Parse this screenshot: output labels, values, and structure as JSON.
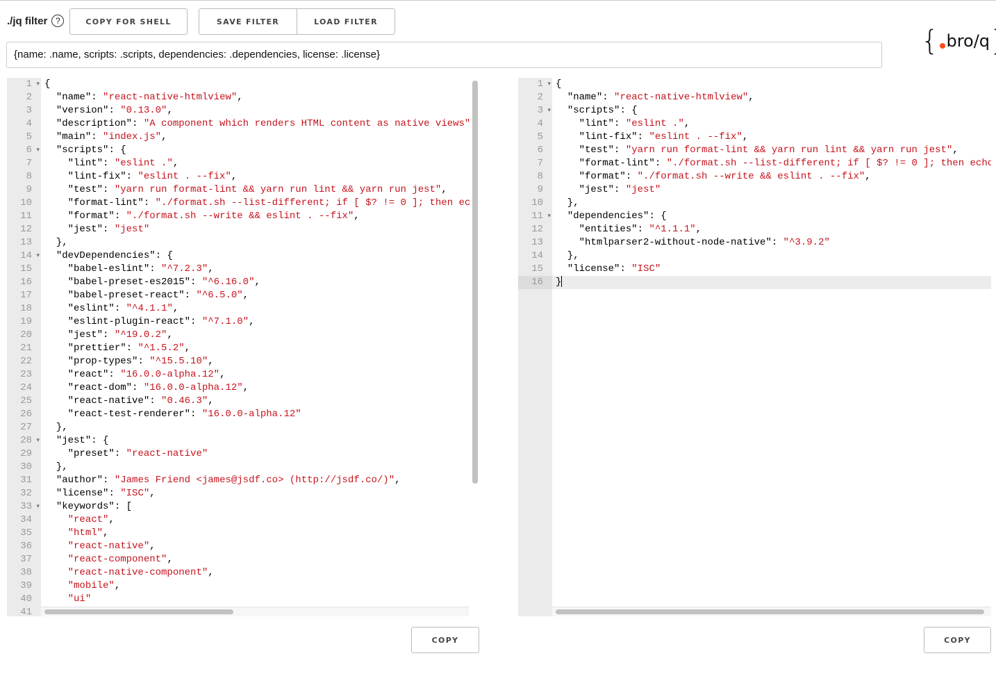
{
  "toolbar": {
    "label": "./jq filter",
    "help_icon": "?",
    "copy_shell": "COPY FOR SHELL",
    "save_filter": "SAVE FILTER",
    "load_filter": "LOAD FILTER"
  },
  "filter": {
    "value": "{name: .name, scripts: .scripts, dependencies: .dependencies, license: .license}"
  },
  "logo": {
    "text": ".bro/q",
    "left_brace": "{",
    "right_brace": "}",
    "dot_color": "#ff4d1a"
  },
  "colors": {
    "string": "#c4141e",
    "gutter": "#ebebeb"
  },
  "input_editor": {
    "copy_label": "COPY",
    "fold_lines": [
      1,
      6,
      14,
      28,
      33
    ],
    "lines": [
      "{",
      "  \"name\": \"react-native-htmlview\",",
      "  \"version\": \"0.13.0\",",
      "  \"description\": \"A component which renders HTML content as native views\"",
      "  \"main\": \"index.js\",",
      "  \"scripts\": {",
      "    \"lint\": \"eslint .\",",
      "    \"lint-fix\": \"eslint . --fix\",",
      "    \"test\": \"yarn run format-lint && yarn run lint && yarn run jest\",",
      "    \"format-lint\": \"./format.sh --list-different; if [ $? != 0 ]; then ec",
      "    \"format\": \"./format.sh --write && eslint . --fix\",",
      "    \"jest\": \"jest\"",
      "  },",
      "  \"devDependencies\": {",
      "    \"babel-eslint\": \"^7.2.3\",",
      "    \"babel-preset-es2015\": \"^6.16.0\",",
      "    \"babel-preset-react\": \"^6.5.0\",",
      "    \"eslint\": \"^4.1.1\",",
      "    \"eslint-plugin-react\": \"^7.1.0\",",
      "    \"jest\": \"^19.0.2\",",
      "    \"prettier\": \"^1.5.2\",",
      "    \"prop-types\": \"^15.5.10\",",
      "    \"react\": \"16.0.0-alpha.12\",",
      "    \"react-dom\": \"16.0.0-alpha.12\",",
      "    \"react-native\": \"0.46.3\",",
      "    \"react-test-renderer\": \"16.0.0-alpha.12\"",
      "  },",
      "  \"jest\": {",
      "    \"preset\": \"react-native\"",
      "  },",
      "  \"author\": \"James Friend <james@jsdf.co> (http://jsdf.co/)\",",
      "  \"license\": \"ISC\",",
      "  \"keywords\": [",
      "    \"react\",",
      "    \"html\",",
      "    \"react-native\",",
      "    \"react-component\",",
      "    \"react-native-component\",",
      "    \"mobile\",",
      "    \"ui\"",
      ""
    ]
  },
  "output_editor": {
    "copy_label": "COPY",
    "fold_lines": [
      1,
      3,
      11
    ],
    "active_line": 16,
    "lines": [
      "{",
      "  \"name\": \"react-native-htmlview\",",
      "  \"scripts\": {",
      "    \"lint\": \"eslint .\",",
      "    \"lint-fix\": \"eslint . --fix\",",
      "    \"test\": \"yarn run format-lint && yarn run lint && yarn run jest\",",
      "    \"format-lint\": \"./format.sh --list-different; if [ $? != 0 ]; then echo",
      "    \"format\": \"./format.sh --write && eslint . --fix\",",
      "    \"jest\": \"jest\"",
      "  },",
      "  \"dependencies\": {",
      "    \"entities\": \"^1.1.1\",",
      "    \"htmlparser2-without-node-native\": \"^3.9.2\"",
      "  },",
      "  \"license\": \"ISC\"",
      "}"
    ]
  }
}
